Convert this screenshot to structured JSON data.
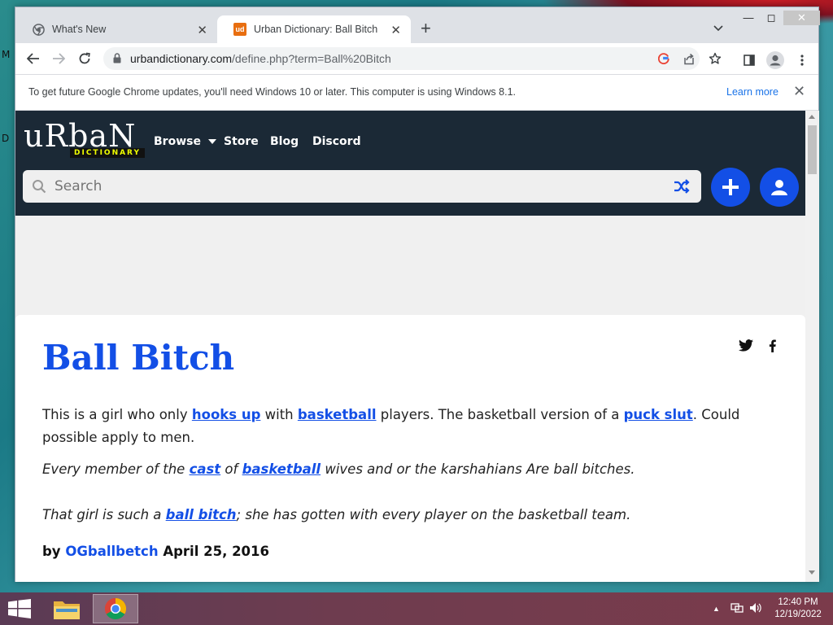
{
  "desktop": {
    "left_letters": [
      "M",
      "D"
    ]
  },
  "browser": {
    "tabs": [
      {
        "label": "What's New",
        "active": false
      },
      {
        "label": "Urban Dictionary: Ball Bitch",
        "active": true,
        "favicon_text": "ud"
      }
    ],
    "new_tab_label": "+",
    "url_host": "urbandictionary.com",
    "url_path": "/define.php?term=Ball%20Bitch",
    "infobar": {
      "message": "To get future Google Chrome updates, you'll need Windows 10 or later. This computer is using Windows 8.1.",
      "link": "Learn more"
    }
  },
  "site": {
    "logo_word": "uRbaN",
    "logo_sub": "DICTIONARY",
    "nav": [
      "Browse",
      "Store",
      "Blog",
      "Discord"
    ],
    "search_placeholder": "Search",
    "colors": {
      "header_bg": "#1b2936",
      "accent": "#134fe6",
      "logo_sub": "#efff00"
    }
  },
  "entry": {
    "word": "Ball Bitch",
    "meaning_parts": [
      {
        "text": "This is a girl who only ",
        "link": false
      },
      {
        "text": "hooks up",
        "link": true
      },
      {
        "text": " with ",
        "link": false
      },
      {
        "text": "basketball",
        "link": true
      },
      {
        "text": " players. The basketball version of a ",
        "link": false
      },
      {
        "text": "puck slut",
        "link": true
      },
      {
        "text": ". Could possible apply to men.",
        "link": false
      }
    ],
    "example1_parts": [
      {
        "text": "Every member of the ",
        "link": false
      },
      {
        "text": "cast",
        "link": true
      },
      {
        "text": " of ",
        "link": false
      },
      {
        "text": "basketball",
        "link": true
      },
      {
        "text": " wives and or the karshahians Are ball bitches.",
        "link": false
      }
    ],
    "example2_parts": [
      {
        "text": "That girl is such a ",
        "link": false
      },
      {
        "text": "ball bitch",
        "link": true
      },
      {
        "text": "; she has gotten with every player on the basketball team.",
        "link": false
      }
    ],
    "by_label": "by",
    "author": "OGballbetch",
    "date": "April 25, 2016"
  },
  "taskbar": {
    "time": "12:40 PM",
    "date": "12/19/2022"
  }
}
